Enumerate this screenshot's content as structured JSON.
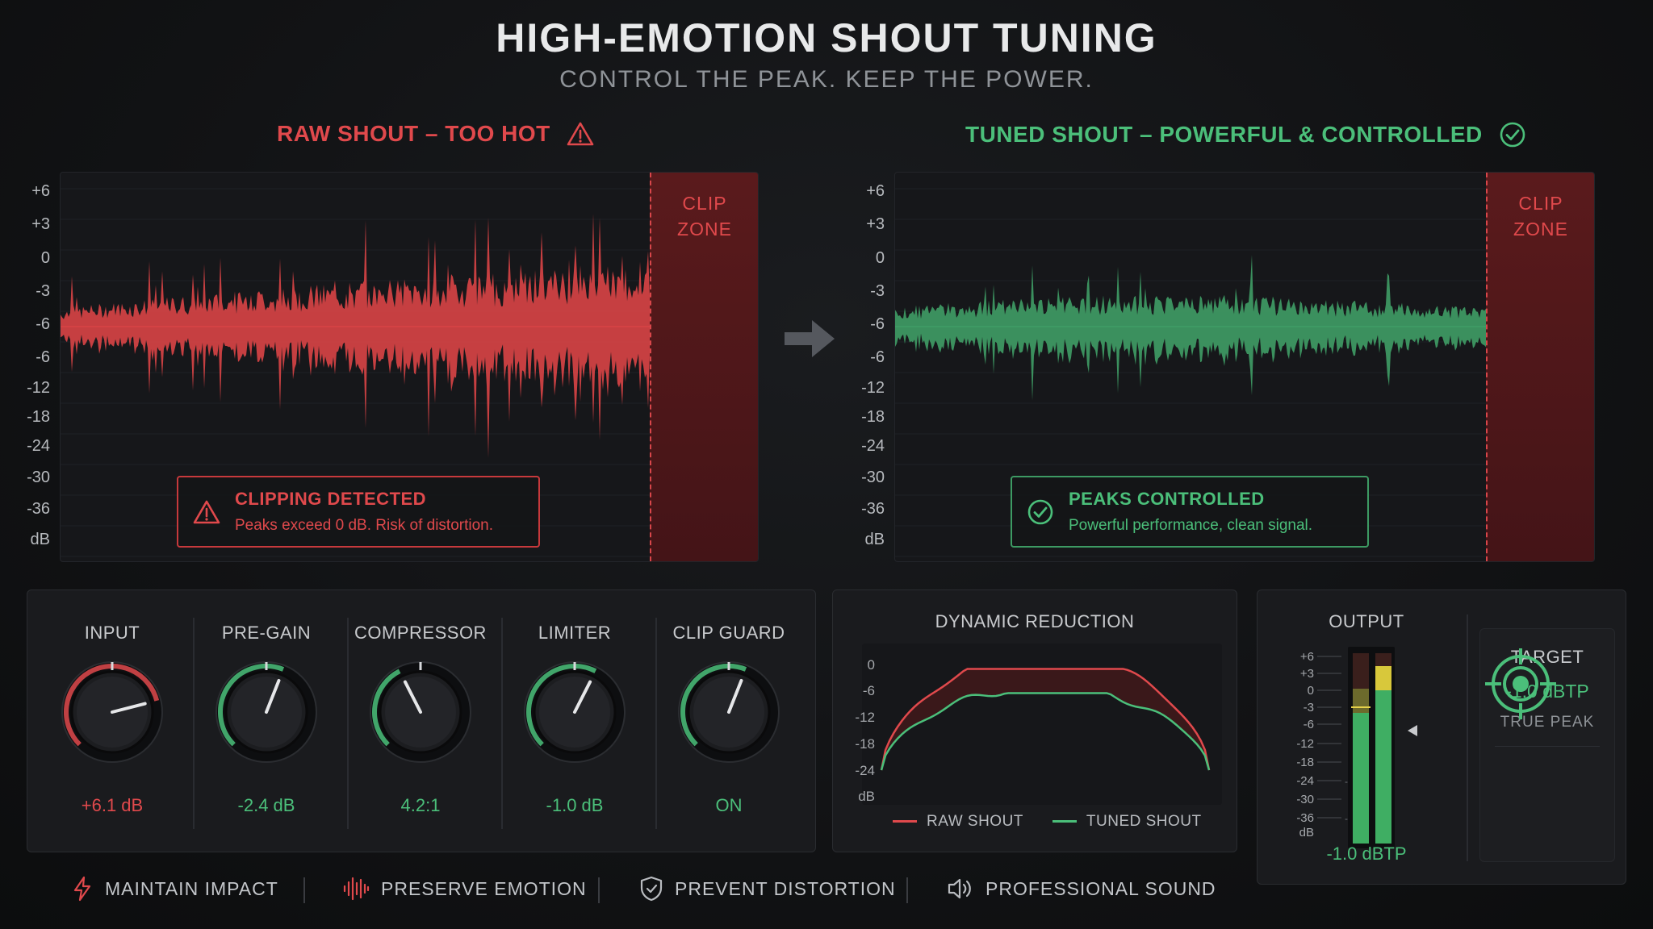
{
  "header": {
    "title": "HIGH-EMOTION SHOUT TUNING",
    "subtitle": "CONTROL THE PEAK. KEEP THE POWER."
  },
  "colors": {
    "raw": "#e0494c",
    "tuned": "#4bbf7a",
    "clipzone": "#4d171a",
    "background": "#121315"
  },
  "raw_panel": {
    "title": "RAW SHOUT – TOO HOT",
    "icon": "warning-icon",
    "clip_label_line1": "CLIP",
    "clip_label_line2": "ZONE",
    "db_ticks": [
      "+6",
      "+3",
      "0",
      "-3",
      "-6",
      "-6",
      "-12",
      "-18",
      "-24",
      "-30",
      "-36",
      "dB"
    ],
    "alert_title": "CLIPPING DETECTED",
    "alert_text": "Peaks exceed 0 dB. Risk of distortion."
  },
  "tuned_panel": {
    "title": "TUNED SHOUT – POWERFUL & CONTROLLED",
    "icon": "check-circle-icon",
    "clip_label_line1": "CLIP",
    "clip_label_line2": "ZONE",
    "db_ticks": [
      "+6",
      "+3",
      "0",
      "-3",
      "-6",
      "-6",
      "-12",
      "-18",
      "-24",
      "-30",
      "-36",
      "dB"
    ],
    "alert_title": "PEAKS CONTROLLED",
    "alert_text": "Powerful performance, clean signal."
  },
  "controls": [
    {
      "name": "INPUT",
      "value": "+6.1 dB",
      "color": "#e0494c",
      "level": 0.78
    },
    {
      "name": "PRE-GAIN",
      "value": "-2.4 dB",
      "color": "#4bbf7a",
      "level": 0.58
    },
    {
      "name": "COMPRESSOR",
      "value": "4.2:1",
      "color": "#4bbf7a",
      "level": 0.4
    },
    {
      "name": "LIMITER",
      "value": "-1.0 dB",
      "color": "#4bbf7a",
      "level": 0.6
    },
    {
      "name": "CLIP GUARD",
      "value": "ON",
      "color": "#4bbf7a",
      "level": 0.58
    }
  ],
  "dynamic_reduction": {
    "title": "DYNAMIC REDUCTION",
    "y_ticks": [
      "0",
      "-6",
      "-12",
      "-18",
      "-24",
      "dB"
    ],
    "legend_raw": "RAW SHOUT",
    "legend_tuned": "TUNED SHOUT"
  },
  "output": {
    "title": "OUTPUT",
    "meter_ticks": [
      "+6",
      "+3",
      "0",
      "-3",
      "-6",
      "-12",
      "-18",
      "-24",
      "-30",
      "-36",
      "dB"
    ],
    "inline_marks": [
      "-24",
      "-36"
    ],
    "value": "-1.0 dBTP",
    "target_title": "TARGET",
    "target_value": "-1.0 dBTP",
    "target_sub": "TRUE PEAK",
    "target_icon": "target-icon"
  },
  "features": [
    {
      "label": "MAINTAIN IMPACT",
      "icon": "bolt-icon"
    },
    {
      "label": "PRESERVE EMOTION",
      "icon": "waveform-icon"
    },
    {
      "label": "PREVENT DISTORTION",
      "icon": "shield-icon"
    },
    {
      "label": "PROFESSIONAL SOUND",
      "icon": "speaker-icon"
    }
  ]
}
